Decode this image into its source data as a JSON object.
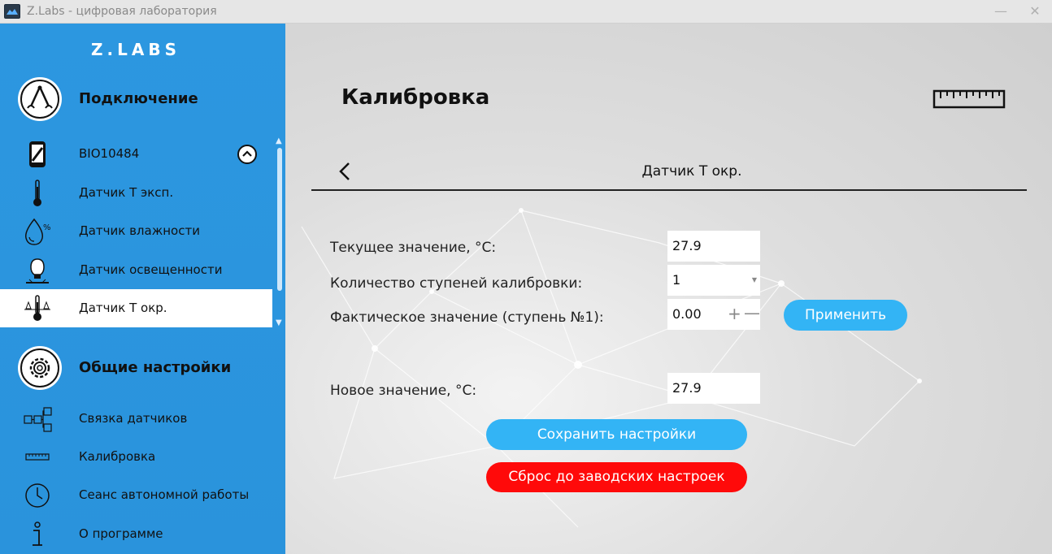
{
  "window": {
    "title": "Z.Labs - цифровая лаборатория",
    "minimize": "—",
    "close": "✕"
  },
  "sidebar": {
    "logo": "Z.LABS",
    "connection": {
      "title": "Подключение",
      "device": "BIO10484",
      "items": [
        {
          "label": "Датчик Т эксп."
        },
        {
          "label": "Датчик влажности"
        },
        {
          "label": "Датчик освещенности"
        },
        {
          "label": "Датчик Т окр."
        }
      ]
    },
    "settings": {
      "title": "Общие настройки",
      "items": [
        {
          "label": "Связка датчиков"
        },
        {
          "label": "Калибровка"
        },
        {
          "label": "Сеанс автономной работы"
        },
        {
          "label": "О программе"
        }
      ]
    }
  },
  "main": {
    "title": "Калибровка",
    "subtitle": "Датчик Т окр.",
    "form": {
      "current_label": "Текущее значение, °С:",
      "current_value": "27.9",
      "steps_label": "Количество ступеней калибровки:",
      "steps_value": "1",
      "actual_label": "Фактическое значение (ступень №1):",
      "actual_value": "0.00",
      "plus": "+",
      "minus": "—",
      "new_label": "Новое значение, °С:",
      "new_value": "27.9"
    },
    "buttons": {
      "apply": "Применить",
      "save": "Сохранить настройки",
      "reset": "Сброс до заводских настроек"
    }
  },
  "colors": {
    "sidebar": "#2c97e0",
    "accent": "#33b4f5",
    "danger": "#ff0a0a"
  }
}
